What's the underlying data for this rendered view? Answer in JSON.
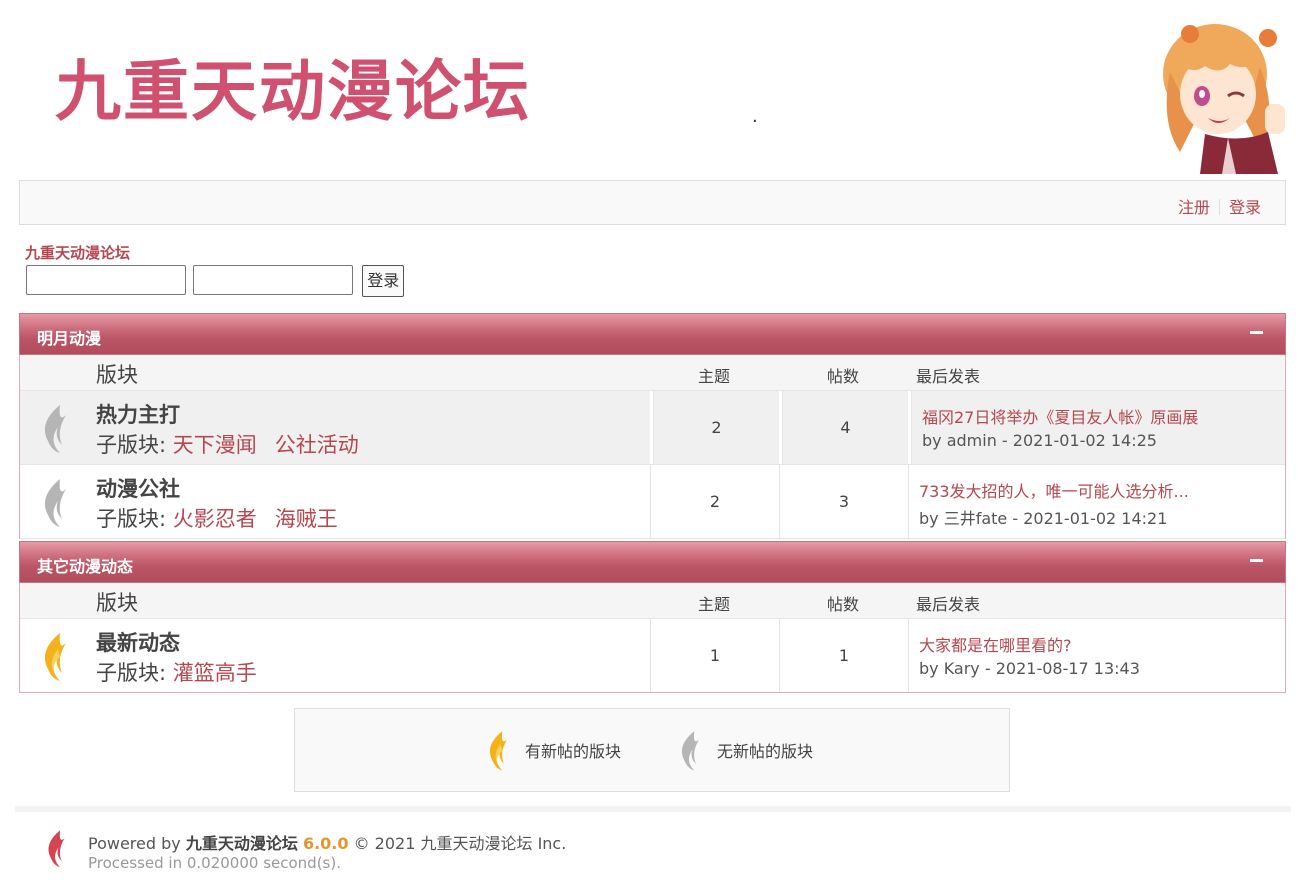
{
  "header": {
    "logo_text": "九重天动漫论坛",
    "dot": "."
  },
  "topnav": {
    "register": "注册",
    "login": "登录"
  },
  "site_link": "九重天动漫论坛",
  "login_form": {
    "username_value": "",
    "password_value": "",
    "submit_label": "登录"
  },
  "columns": {
    "forum": "版块",
    "topics": "主题",
    "posts": "帖数",
    "last_post": "最后发表"
  },
  "categories": [
    {
      "title": "明月动漫",
      "forums": [
        {
          "name": "热力主打",
          "subs_label": "子版块: ",
          "subs": [
            "天下漫闻",
            "公社活动"
          ],
          "topics": "2",
          "posts": "4",
          "last_title": "福冈27日将举办《夏目友人帐》原画展",
          "last_by": "by admin - 2021-01-02 14:25",
          "has_new": false
        },
        {
          "name": "动漫公社",
          "subs_label": "子版块: ",
          "subs": [
            "火影忍者",
            "海贼王"
          ],
          "topics": "2",
          "posts": "3",
          "last_title": "733发大招的人，唯一可能人选分析...",
          "last_by": "by 三井fate - 2021-01-02 14:21",
          "has_new": false
        }
      ]
    },
    {
      "title": "其它动漫动态",
      "forums": [
        {
          "name": "最新动态",
          "subs_label": "子版块: ",
          "subs": [
            "灌篮高手"
          ],
          "topics": "1",
          "posts": "1",
          "last_title": "大家都是在哪里看的?",
          "last_by": "by Kary - 2021-08-17 13:43",
          "has_new": true
        }
      ]
    }
  ],
  "legend": {
    "new_label": "有新帖的版块",
    "no_new_label": "无新帖的版块"
  },
  "footer": {
    "powered_by": "Powered by",
    "site": "九重天动漫论坛",
    "version": "6.0.0",
    "copyright": "© 2021 九重天动漫论坛 Inc.",
    "processed": "Processed in 0.020000 second(s)."
  },
  "colors": {
    "accent": "#b6474f",
    "category_header": "#bb5666",
    "new_flame": "#f3b11a",
    "old_flame": "#aaaaaa"
  }
}
